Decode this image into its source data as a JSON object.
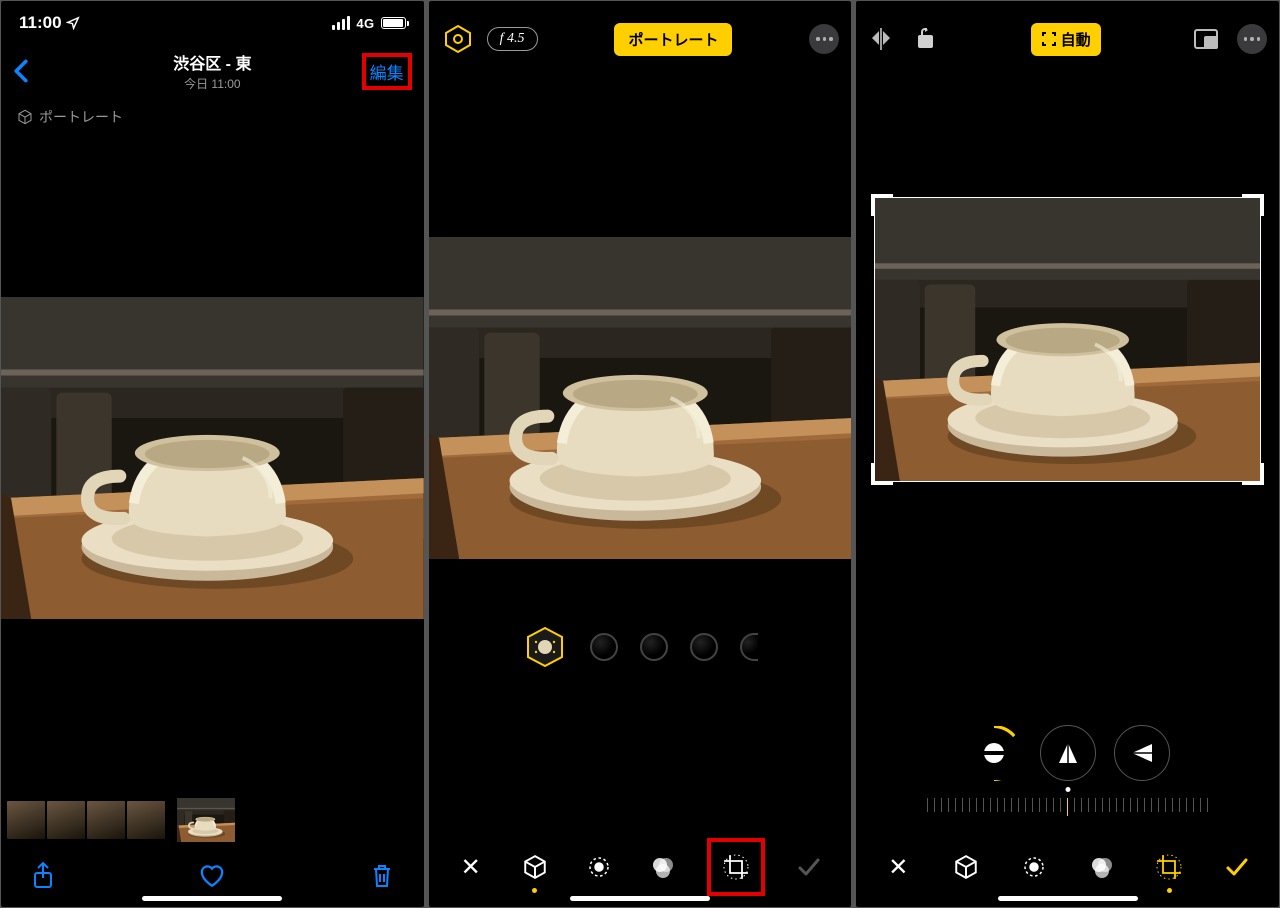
{
  "panel1": {
    "status": {
      "time": "11:00",
      "network": "4G"
    },
    "nav": {
      "title": "渋谷区 - 東",
      "subtitle": "今日 11:00",
      "edit_label": "編集"
    },
    "badge": {
      "mode_label": "ポートレート"
    }
  },
  "panel2": {
    "toolbar": {
      "aperture_label": "f 4.5",
      "mode_pill": "ポートレート"
    }
  },
  "panel3": {
    "toolbar": {
      "auto_label": "自動"
    }
  }
}
